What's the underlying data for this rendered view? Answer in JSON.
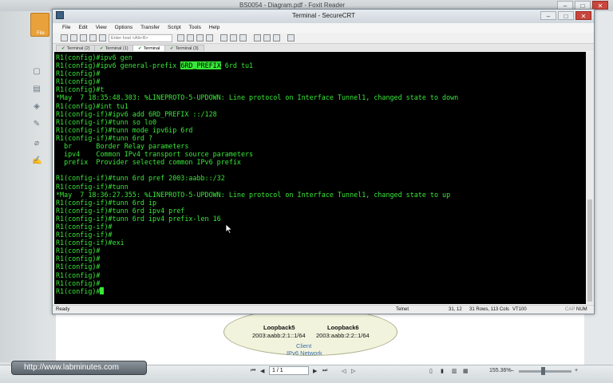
{
  "foxit": {
    "title": "BS0054 - Diagram.pdf - Foxit Reader",
    "file_tab": "File",
    "page_box": "1 / 1",
    "zoom": "155.36%"
  },
  "diagram": {
    "loopback5_title": "Loopback5",
    "loopback5_addr": "2003:aabb:2:1::1/64",
    "loopback6_title": "Loopback6",
    "loopback6_addr": "2003:aabb:2:2::1/64",
    "client": "Client",
    "network": "IPv6 Network"
  },
  "watermark": {
    "url": "http://www.labminutes.com"
  },
  "crt": {
    "title": "Terminal - SecureCRT",
    "menu": [
      "File",
      "Edit",
      "View",
      "Options",
      "Transfer",
      "Script",
      "Tools",
      "Help"
    ],
    "host_placeholder": "Enter host <Alt+R>",
    "tabs": [
      "Terminal (2)",
      "Terminal (1)",
      "Terminal",
      "Terminal (3)"
    ],
    "status": {
      "ready": "Ready",
      "protocol": "Telnet",
      "position": "31, 12",
      "size": "31 Rows, 113 Cols",
      "emulation": "VT100",
      "caps": "CAP",
      "num": "NUM"
    },
    "terminal": {
      "l01": "R1(config)#ipv6 gen",
      "l02a": "R1(config)#ipv6 general-prefix ",
      "l02b": "6RD_PREFIX",
      "l02c": " 6rd tu1",
      "l03": "R1(config)#",
      "l04": "R1(config)#",
      "l05": "R1(config)#t",
      "l06": "*May  7 18:35:48.303: %LINEPROTO-5-UPDOWN: Line protocol on Interface Tunnel1, changed state to down",
      "l07": "R1(config)#int tu1",
      "l08": "R1(config-if)#ipv6 add 6RD_PREFIX ::/128",
      "l09": "R1(config-if)#tunn so lo0",
      "l10": "R1(config-if)#tunn mode ipv6ip 6rd",
      "l11": "R1(config-if)#tunn 6rd ?",
      "l12": "  br      Border Relay parameters",
      "l13": "  ipv4    Common IPv4 transport source parameters",
      "l14": "  prefix  Provider selected common IPv6 prefix",
      "l15": "",
      "l16": "R1(config-if)#tunn 6rd pref 2003:aabb::/32",
      "l17": "R1(config-if)#tunn",
      "l18": "*May  7 18:36:27.355: %LINEPROTO-5-UPDOWN: Line protocol on Interface Tunnel1, changed state to up",
      "l19": "R1(config-if)#tunn 6rd ip",
      "l20": "R1(config-if)#tunn 6rd ipv4 pref",
      "l21": "R1(config-if)#tunn 6rd ipv4 prefix-len 16",
      "l22": "R1(config-if)#",
      "l23": "R1(config-if)#",
      "l24": "R1(config-if)#exi",
      "l25": "R1(config)#",
      "l26": "R1(config)#",
      "l27": "R1(config)#",
      "l28": "R1(config)#",
      "l29": "R1(config)#",
      "l30": "R1(config)#"
    }
  }
}
